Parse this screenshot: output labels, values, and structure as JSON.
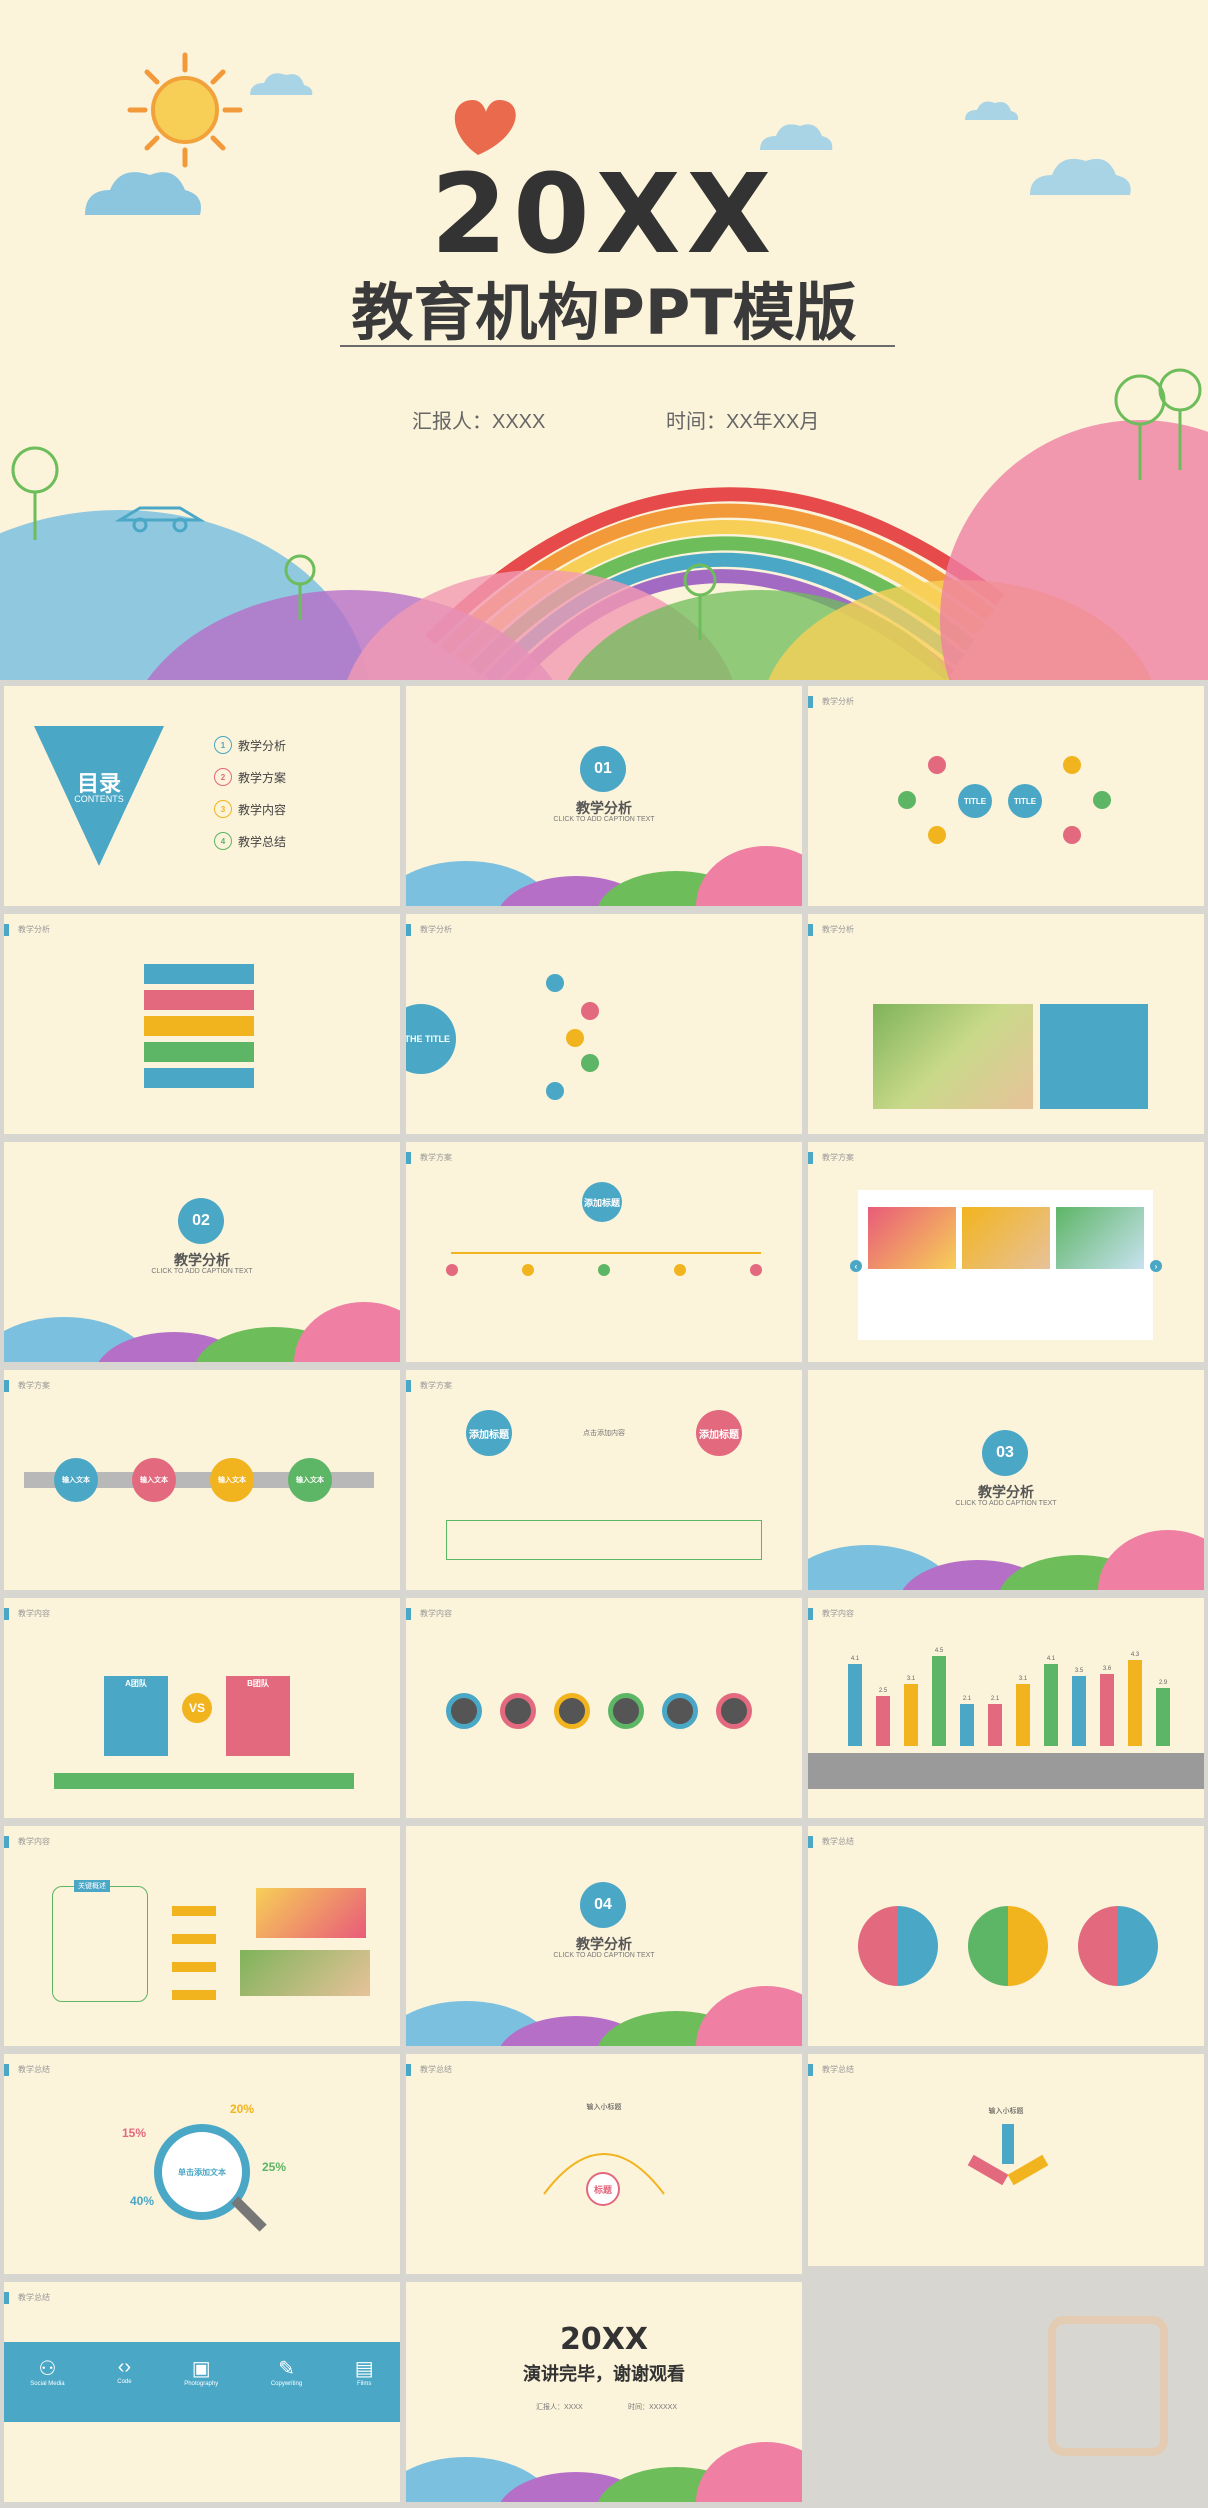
{
  "cover": {
    "title_num": "20XX",
    "title": "教育机构PPT模版",
    "reporter": "汇报人：XXXX",
    "time": "时间：XX年XX月"
  },
  "toc": {
    "title": "目录",
    "subtitle": "CONTENTS",
    "items": [
      {
        "n": "1",
        "label": "教学分析"
      },
      {
        "n": "2",
        "label": "教学方案"
      },
      {
        "n": "3",
        "label": "教学内容"
      },
      {
        "n": "4",
        "label": "教学总结"
      }
    ]
  },
  "sections": [
    {
      "num": "01",
      "title": "教学分析",
      "sub": "CLICK TO ADD CAPTION TEXT"
    },
    {
      "num": "02",
      "title": "教学分析",
      "sub": "CLICK TO ADD CAPTION TEXT"
    },
    {
      "num": "03",
      "title": "教学分析",
      "sub": "CLICK TO ADD CAPTION TEXT"
    },
    {
      "num": "04",
      "title": "教学分析",
      "sub": "CLICK TO ADD CAPTION TEXT"
    }
  ],
  "heads": {
    "analysis": "教学分析",
    "plan": "教学方案",
    "content": "教学内容",
    "summary": "教学总结"
  },
  "slide_texts": {
    "title_circle": "TITLE",
    "the_title": "THE TITLE",
    "add_title": "添加标题",
    "click_add": "点击添加内容",
    "input_text": "输入文本",
    "vs": "VS",
    "a_group": "A团队",
    "b_group": "B团队",
    "single_text": "单击添加文本",
    "input_small": "输入小标题",
    "tag": "标题",
    "social": [
      "Social Media",
      "Code",
      "Photography",
      "Copywriting",
      "Films"
    ],
    "percents": [
      "20%",
      "15%",
      "25%",
      "40%"
    ],
    "bar_values": [
      4.1,
      2.5,
      3.1,
      4.5,
      2.1,
      2.1,
      3.1,
      4.1,
      3.5,
      3.6,
      4.3,
      2.9
    ],
    "kv": "关键概述",
    "end_num": "20XX",
    "end_title": "演讲完毕，谢谢观看",
    "end_rep": "汇报人：XXXX",
    "end_time": "时间：XXXXXX"
  },
  "colors": {
    "blue": "#4aa7c6",
    "pink": "#e3697e",
    "yellow": "#f2b41e",
    "green": "#5db566",
    "bg": "#fbf3da"
  }
}
